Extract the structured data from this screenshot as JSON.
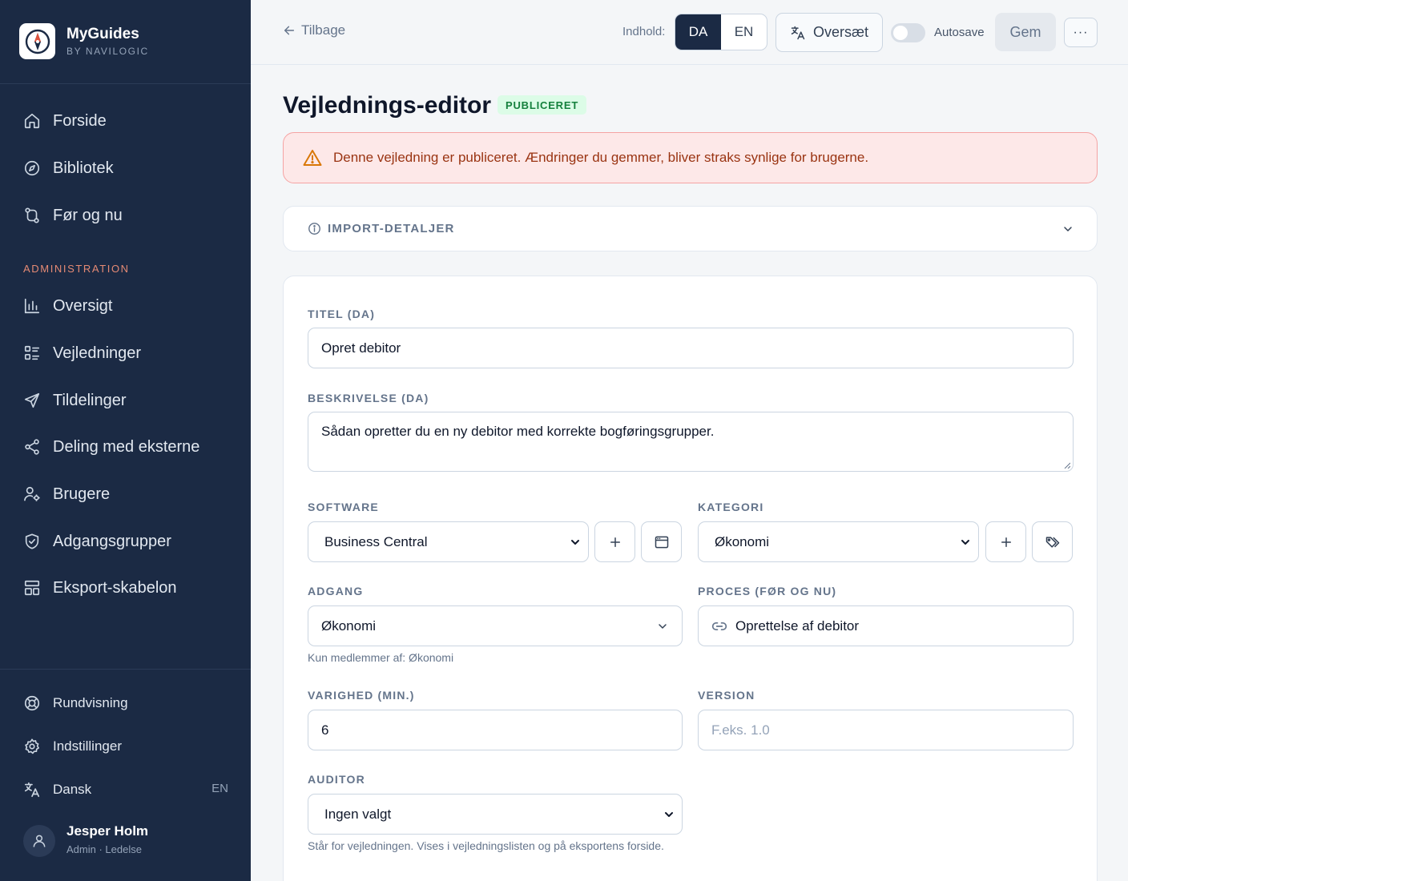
{
  "brand": {
    "name": "MyGuides",
    "sub": "BY NAVILOGIC"
  },
  "sidebar": {
    "items": [
      {
        "label": "Forside",
        "icon": "home-icon"
      },
      {
        "label": "Bibliotek",
        "icon": "compass-icon"
      },
      {
        "label": "Før og nu",
        "icon": "route-icon"
      }
    ],
    "section_label": "ADMINISTRATION",
    "admin_items": [
      {
        "label": "Oversigt",
        "icon": "bar-chart-icon"
      },
      {
        "label": "Vejledninger",
        "icon": "list-icon"
      },
      {
        "label": "Tildelinger",
        "icon": "send-icon"
      },
      {
        "label": "Deling med eksterne",
        "icon": "share-icon"
      },
      {
        "label": "Brugere",
        "icon": "user-gear-icon"
      },
      {
        "label": "Adgangsgrupper",
        "icon": "shield-icon"
      },
      {
        "label": "Eksport-skabelon",
        "icon": "layout-icon"
      }
    ],
    "bottom_items": [
      {
        "label": "Rundvisning",
        "icon": "lifebuoy-icon"
      },
      {
        "label": "Indstillinger",
        "icon": "gear-icon"
      },
      {
        "label": "Dansk",
        "icon": "translate-icon",
        "tag": "EN"
      }
    ],
    "user": {
      "name": "Jesper Holm",
      "role": "Admin · Ledelse"
    }
  },
  "topbar": {
    "back_label": "Tilbage",
    "content_label": "Indhold:",
    "lang_options": [
      "DA",
      "EN"
    ],
    "lang_selected": "DA",
    "translate_label": "Oversæt",
    "autosave_label": "Autosave",
    "autosave_on": false,
    "save_label": "Gem",
    "more_label": "···"
  },
  "page": {
    "title": "Vejlednings-editor",
    "status_badge": "PUBLICERET",
    "alert": "Denne vejledning er publiceret. Ændringer du gemmer, bliver straks synlige for brugerne.",
    "import_label": "IMPORT-DETALJER"
  },
  "form": {
    "title_label": "TITEL (DA)",
    "title_value": "Opret debitor",
    "description_label": "BESKRIVELSE (DA)",
    "description_value": "Sådan opretter du en ny debitor med korrekte bogføringsgrupper.",
    "software_label": "SOFTWARE",
    "software_value": "Business Central",
    "category_label": "KATEGORI",
    "category_value": "Økonomi",
    "access_label": "ADGANG",
    "access_value": "Økonomi",
    "access_hint": "Kun medlemmer af: Økonomi",
    "process_label": "PROCES (FØR OG NU)",
    "process_value": "Oprettelse af debitor",
    "duration_label": "VARIGHED (MIN.)",
    "duration_value": "6",
    "version_label": "VERSION",
    "version_placeholder": "F.eks. 1.0",
    "auditor_label": "AUDITOR",
    "auditor_value": "Ingen valgt",
    "auditor_hint": "Står for vejledningen. Vises i vejledningslisten og på eksportens forside."
  },
  "colors": {
    "sidebar_bg": "#1b2a44",
    "section_accent": "#e58a74",
    "badge_green": "#15803d",
    "alert_text": "#9a3412",
    "alert_bg": "#fde8e8"
  }
}
